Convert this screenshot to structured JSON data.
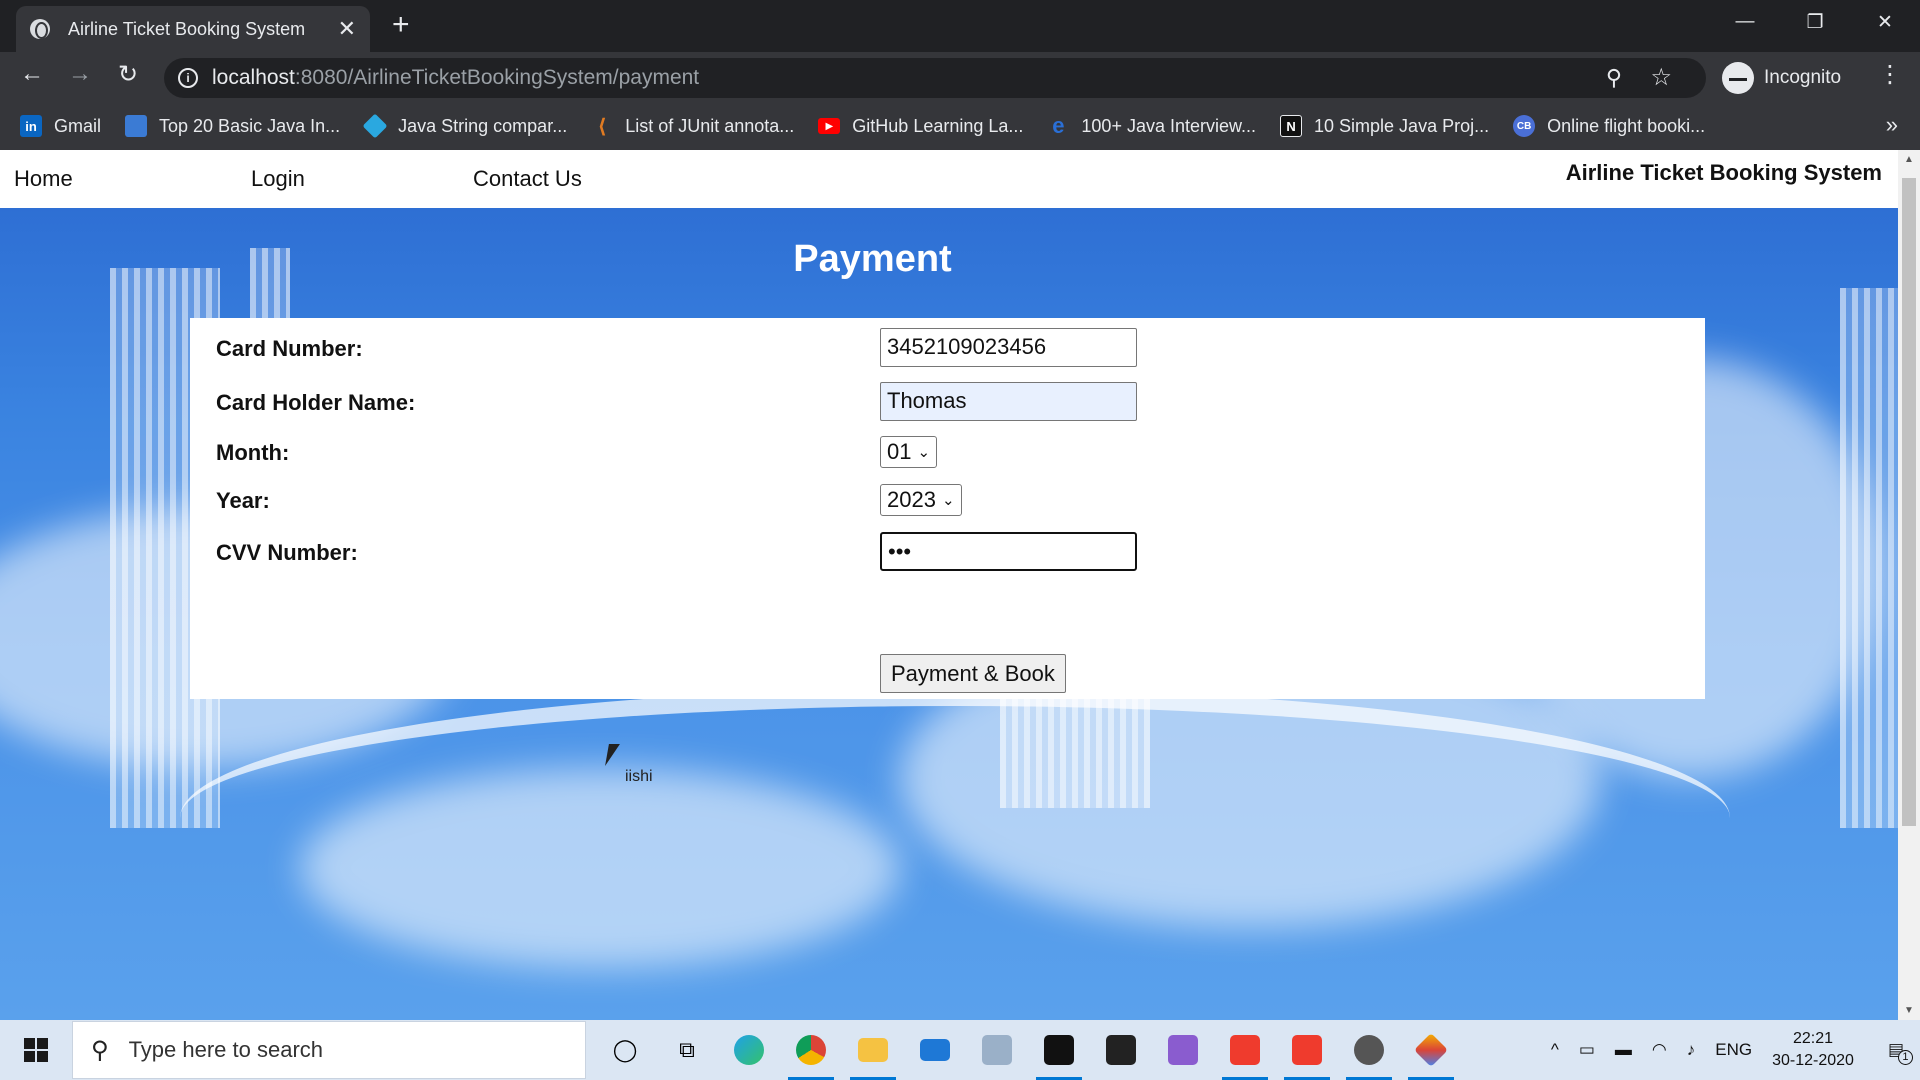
{
  "browser": {
    "tab_title": "Airline Ticket Booking System",
    "tab_close": "✕",
    "new_tab": "+",
    "url_host": "localhost",
    "url_rest": ":8080/AirlineTicketBookingSystem/payment",
    "profile_label": "Incognito",
    "win_controls": [
      "—",
      "❐",
      "✕"
    ]
  },
  "bookmarks": [
    {
      "label": "Gmail",
      "icon": "linkedin-icon",
      "badge": "in",
      "color": "#0a66c2"
    },
    {
      "label": "Top 20 Basic Java In...",
      "icon": "page-icon",
      "badge": "",
      "color": "#3b7bd4"
    },
    {
      "label": "Java String compar...",
      "icon": "diamond-icon",
      "badge": "",
      "color": "#2aa8e0"
    },
    {
      "label": "List of JUnit annota...",
      "icon": "feather-icon",
      "badge": "",
      "color": "#e07b22"
    },
    {
      "label": "GitHub Learning La...",
      "icon": "youtube-icon",
      "badge": "▶",
      "color": "#ff0000"
    },
    {
      "label": "100+ Java Interview...",
      "icon": "e-icon",
      "badge": "e",
      "color": "#2a6fd6"
    },
    {
      "label": "10 Simple Java Proj...",
      "icon": "n-icon",
      "badge": "N",
      "color": "#111111"
    },
    {
      "label": "Online flight booki...",
      "icon": "cb-icon",
      "badge": "CB",
      "color": "#4a6fd6"
    }
  ],
  "bookmarks_more": "»",
  "site": {
    "nav": {
      "home": "Home",
      "login": "Login",
      "contact": "Contact Us"
    },
    "brand": "Airline Ticket Booking System",
    "heading": "Payment"
  },
  "form": {
    "card_number_label": "Card Number:",
    "card_number_value": "3452109023456",
    "card_holder_label": "Card Holder Name:",
    "card_holder_value": "Thomas",
    "month_label": "Month:",
    "month_value": "01",
    "year_label": "Year:",
    "year_value": "2023",
    "cvv_label": "CVV Number:",
    "cvv_value": "•••",
    "submit_label": "Payment & Book"
  },
  "overlay_text": "iishi",
  "taskbar": {
    "search_placeholder": "Type here to search",
    "language": "ENG",
    "time": "22:21",
    "date": "30-12-2020",
    "notification_count": "1"
  }
}
